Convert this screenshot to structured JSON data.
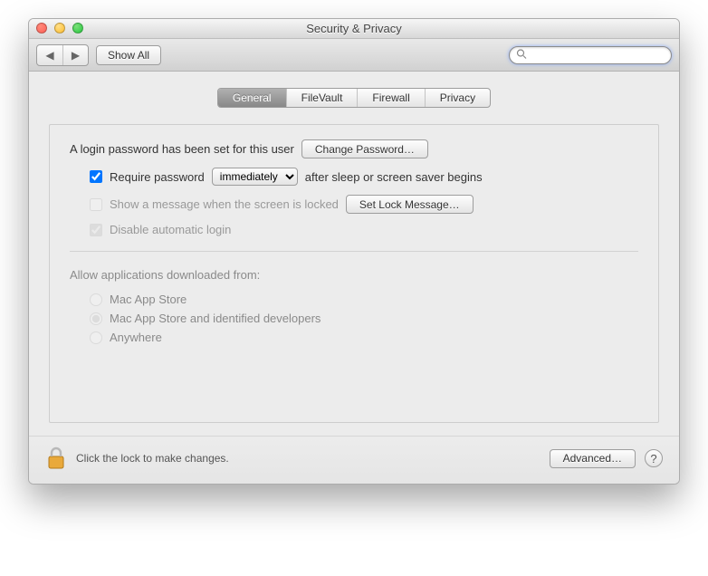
{
  "window": {
    "title": "Security & Privacy"
  },
  "toolbar": {
    "show_all": "Show All",
    "search_placeholder": ""
  },
  "tabs": [
    {
      "label": "General",
      "active": true
    },
    {
      "label": "FileVault",
      "active": false
    },
    {
      "label": "Firewall",
      "active": false
    },
    {
      "label": "Privacy",
      "active": false
    }
  ],
  "login": {
    "status_text": "A login password has been set for this user",
    "change_btn": "Change Password…",
    "require_password": {
      "checked": true,
      "label_before": "Require password",
      "delay_selected": "immediately",
      "label_after": "after sleep or screen saver begins"
    },
    "show_message": {
      "checked": false,
      "enabled": false,
      "label": "Show a message when the screen is locked",
      "button": "Set Lock Message…"
    },
    "disable_auto_login": {
      "checked": true,
      "enabled": false,
      "label": "Disable automatic login"
    }
  },
  "gatekeeper": {
    "section_label": "Allow applications downloaded from:",
    "options": [
      {
        "label": "Mac App Store",
        "selected": false
      },
      {
        "label": "Mac App Store and identified developers",
        "selected": true
      },
      {
        "label": "Anywhere",
        "selected": false
      }
    ],
    "enabled": false
  },
  "footer": {
    "lock_text": "Click the lock to make changes.",
    "advanced_btn": "Advanced…"
  }
}
